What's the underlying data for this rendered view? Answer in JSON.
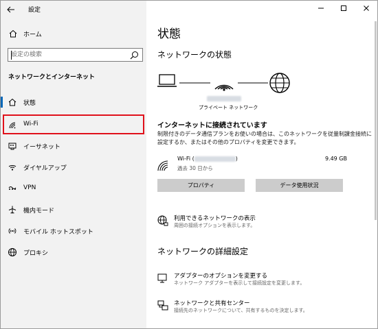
{
  "window": {
    "title": "設定"
  },
  "window_controls": [
    "minimize",
    "maximize",
    "close"
  ],
  "sidebar": {
    "home_label": "ホーム",
    "search_placeholder": "設定の検索",
    "section_heading": "ネットワークとインターネット",
    "items": [
      {
        "label": "状態",
        "icon": "home-status-icon",
        "active": true
      },
      {
        "label": "Wi-Fi",
        "icon": "wifi-icon",
        "highlighted": true
      },
      {
        "label": "イーサネット",
        "icon": "ethernet-icon"
      },
      {
        "label": "ダイヤルアップ",
        "icon": "dialup-icon"
      },
      {
        "label": "VPN",
        "icon": "vpn-icon"
      },
      {
        "label": "機内モード",
        "icon": "airplane-icon"
      },
      {
        "label": "モバイル ホットスポット",
        "icon": "hotspot-icon"
      },
      {
        "label": "プロキシ",
        "icon": "globe-icon"
      }
    ]
  },
  "main": {
    "page_title": "状態",
    "network_status_heading": "ネットワークの状態",
    "network_profile_label": "プライベート ネットワーク",
    "connected_title": "インターネットに接続されています",
    "connected_desc": "制限付きのデータ通信プランをお使いの場合は、このネットワークを従量制課金接続に設定するか、またはその他のプロパティを変更できます。",
    "wifi": {
      "name_prefix": "Wi-Fi (",
      "name_suffix": ")",
      "since": "過去 30 日から",
      "usage": "9.49 GB"
    },
    "buttons": {
      "properties": "プロパティ",
      "data_usage": "データ使用状況"
    },
    "available_networks": {
      "title": "利用できるネットワークの表示",
      "subtitle": "周囲の接続オプションを表示します。"
    },
    "advanced_heading": "ネットワークの詳細設定",
    "adapter_options": {
      "title": "アダプターのオプションを変更する",
      "subtitle": "ネットワーク アダプターを表示して接続設定を変更します。"
    },
    "sharing_center": {
      "title": "ネットワークと共有センター",
      "subtitle": "接続先のネットワークについて、共有するものを決定します。"
    }
  },
  "colors": {
    "accent": "#0067b8",
    "highlight_border": "#e0101a",
    "sidebar_bg": "#f2f2f2",
    "button_bg": "#cccccc"
  }
}
